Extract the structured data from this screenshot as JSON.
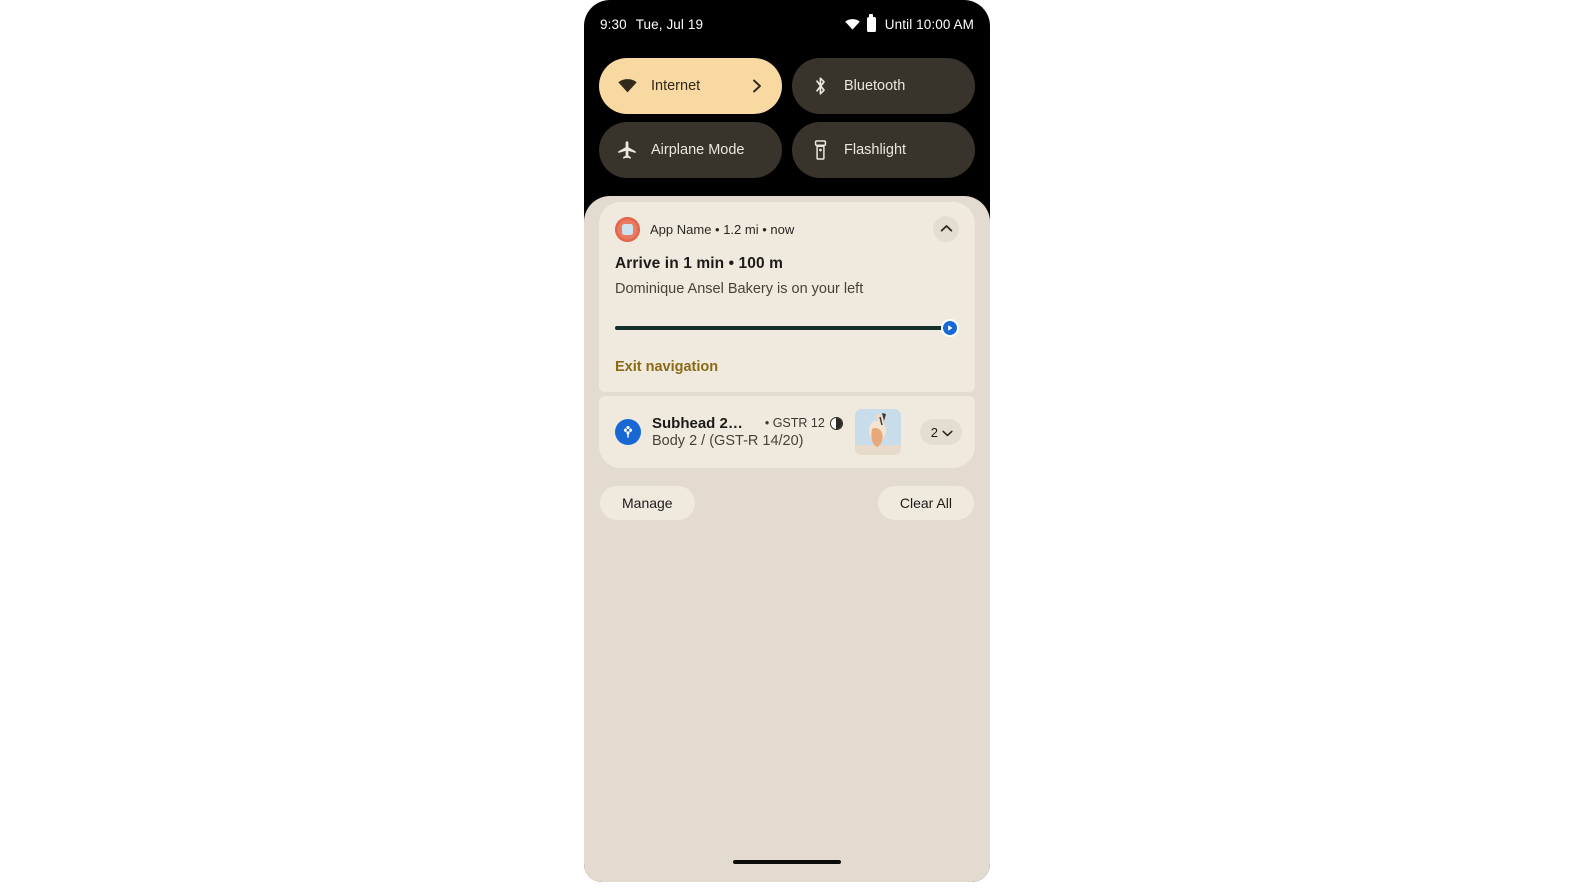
{
  "status_bar": {
    "time": "9:30",
    "date": "Tue, Jul 19",
    "wifi_icon": "wifi-icon",
    "battery_icon": "battery-icon",
    "dnd_until": "Until 10:00 AM"
  },
  "quick_settings": {
    "tiles": [
      {
        "label": "Internet",
        "icon": "wifi-icon",
        "active": true,
        "has_chevron": true
      },
      {
        "label": "Bluetooth",
        "icon": "bluetooth-icon",
        "active": false,
        "has_chevron": false
      },
      {
        "label": "Airplane Mode",
        "icon": "airplane-icon",
        "active": false,
        "has_chevron": false
      },
      {
        "label": "Flashlight",
        "icon": "flashlight-icon",
        "active": false,
        "has_chevron": false
      }
    ]
  },
  "notifications": [
    {
      "app_name": "App Name",
      "distance": "1.2 mi",
      "time": "now",
      "header_line": "App Name • 1.2 mi • now",
      "title": "Arrive in 1 min • 100 m",
      "body": "Dominique Ansel Bakery is on your left",
      "action_label": "Exit navigation",
      "progress_percent": 100,
      "collapse_icon": "chevron-up-icon",
      "nav_knob_icon": "navigation-arrow-icon"
    },
    {
      "title": "Subhead 2…",
      "sub_info": "• GSTR 12",
      "sub_info_icon": "half-circle-icon",
      "body": "Body 2 / (GST-R 14/20)",
      "group_count": "2",
      "group_expand_icon": "chevron-down-icon",
      "app_icon": "pinwheel-icon",
      "thumbnail": "photo-thumbnail"
    }
  ],
  "footer": {
    "manage_label": "Manage",
    "clear_all_label": "Clear All"
  },
  "colors": {
    "accent_tile_active": "#f7d9a1",
    "tile_inactive": "#38332b",
    "panel_background": "#e3dbcf",
    "card_background": "#f0eade",
    "action_text": "#8a6a16",
    "progress_fill": "#123029",
    "nav_knob": "#1669d6",
    "app_icon_1": "#e97b62",
    "app_icon_2": "#1868d4",
    "status_bar_background": "#000000"
  }
}
